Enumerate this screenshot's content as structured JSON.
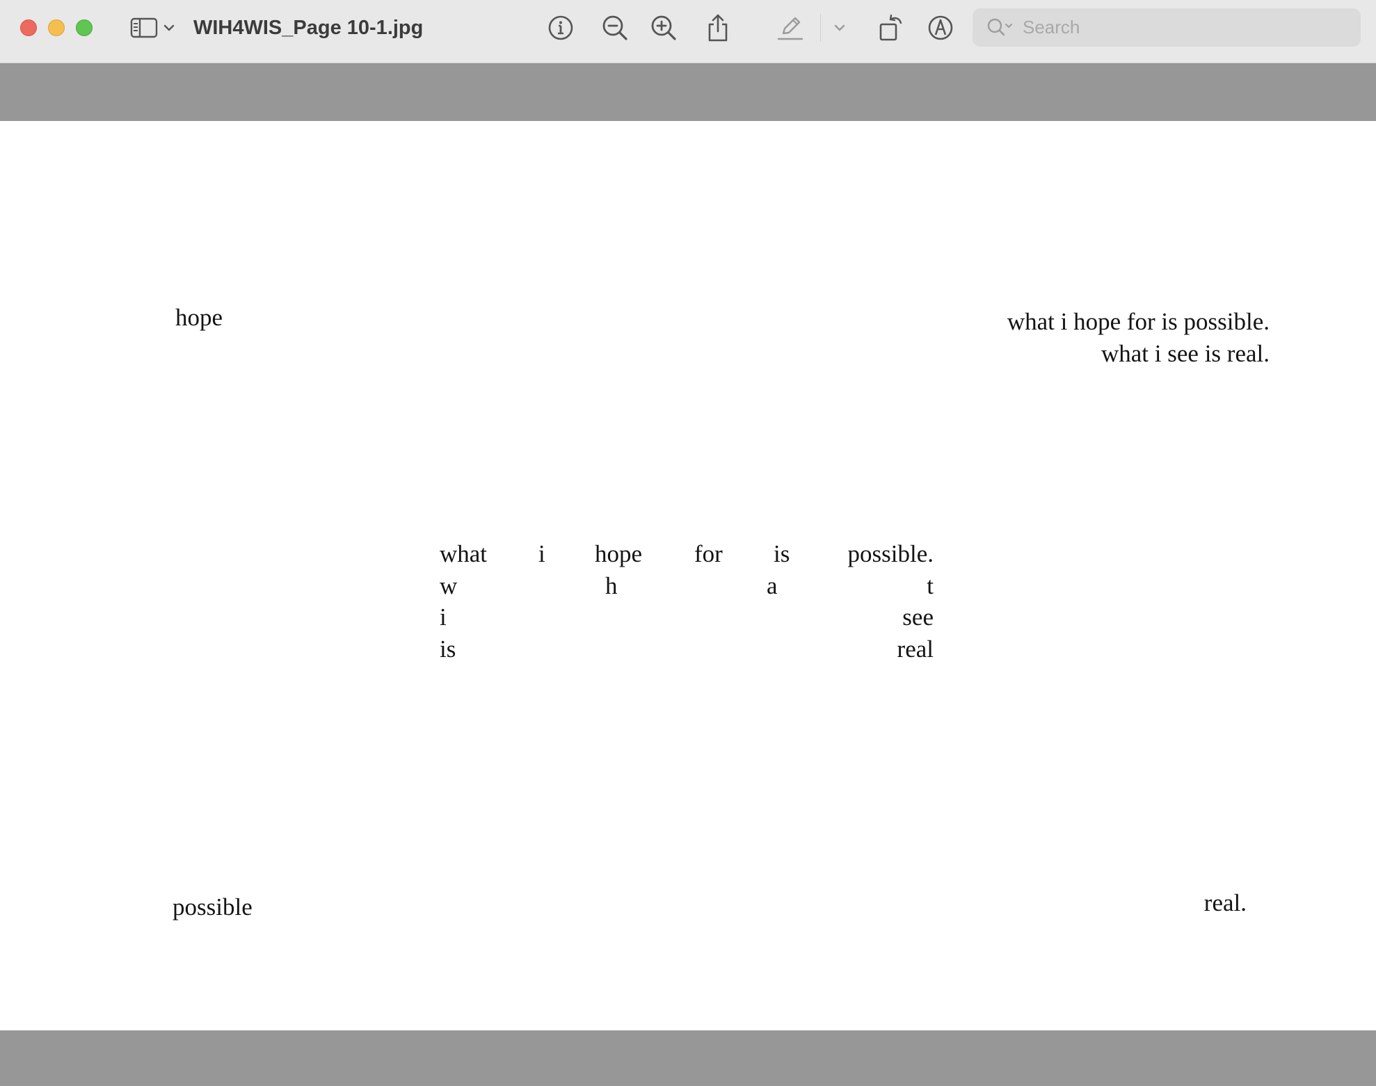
{
  "window": {
    "title": "WIH4WIS_Page 10-1.jpg"
  },
  "toolbar": {
    "icons": {
      "sidebar": "sidebar-icon",
      "sidebar_menu": "chevron-down-icon",
      "info": "info-icon",
      "zoom_out": "zoom-out-icon",
      "zoom_in": "zoom-in-icon",
      "share": "share-icon",
      "highlight": "pencil-icon",
      "markup_menu": "chevron-down-icon",
      "rotate": "rotate-icon",
      "markup": "markup-icon"
    }
  },
  "search": {
    "placeholder": "Search"
  },
  "document": {
    "top_left": "hope",
    "top_right": [
      "what i hope for is possible.",
      "what i see is real."
    ],
    "center_row1": [
      "what",
      "i",
      "hope",
      "for",
      "is",
      "possible."
    ],
    "center_row2": [
      "w",
      "h",
      "a",
      "t"
    ],
    "center_row3": [
      "i",
      "see"
    ],
    "center_row4": [
      "is",
      "real"
    ],
    "bottom_left": "possible",
    "bottom_right": "real."
  },
  "colors": {
    "titlebar": "#e9e8e8",
    "canvas": "#979797",
    "page": "#ffffff",
    "text": "#141414",
    "close": "#ed6a5e",
    "minimize": "#f5bf4f",
    "maximize": "#61c554"
  }
}
